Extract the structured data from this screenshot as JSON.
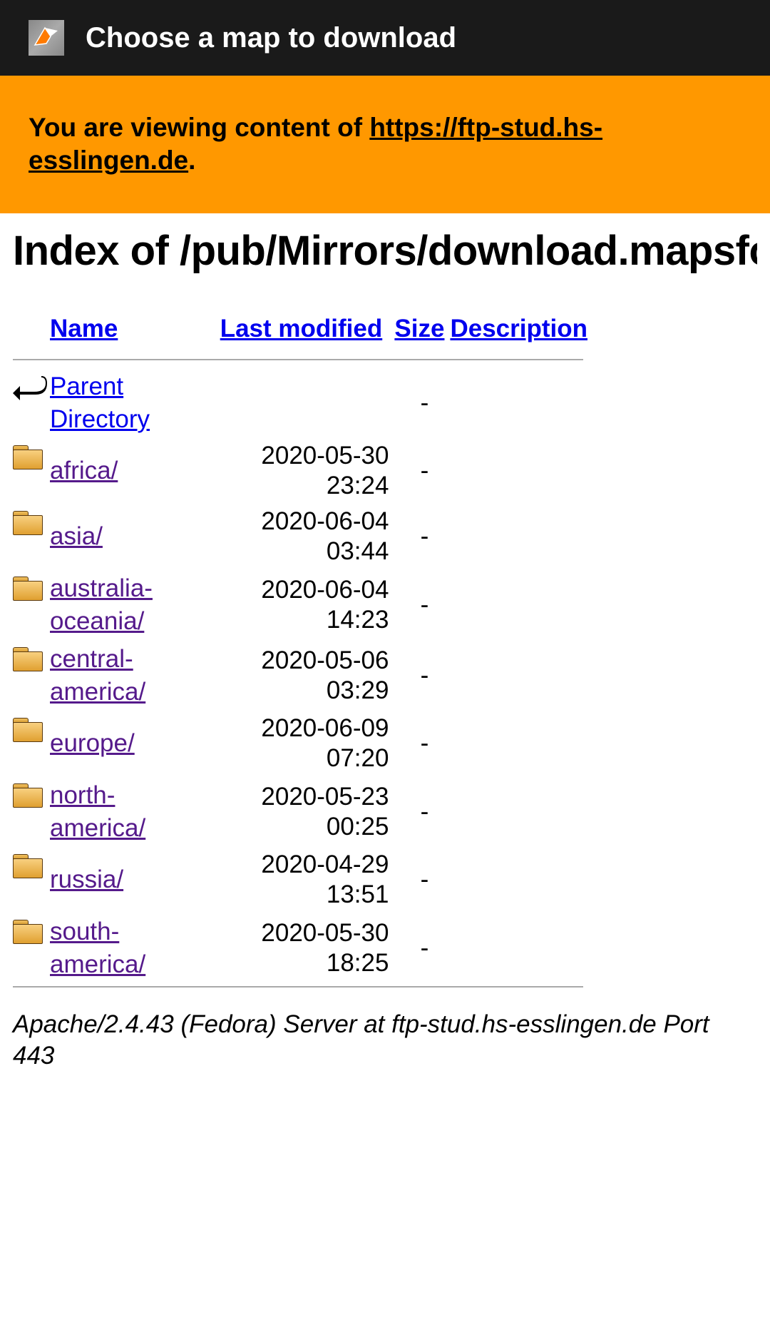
{
  "header": {
    "title": "Choose a map to download"
  },
  "notice": {
    "prefix": "You are viewing content of ",
    "link_text": "https://ftp-stud.hs-esslingen.de",
    "suffix": "."
  },
  "index_title": "Index of /pub/Mirrors/download.mapsforge.org",
  "columns": {
    "name": "Name",
    "last_modified": "Last modified",
    "size": "Size",
    "description": "Description"
  },
  "parent": {
    "label": "Parent Directory",
    "size": "-"
  },
  "entries": [
    {
      "name": "africa/",
      "date": "2020-05-30 23:24",
      "size": "-"
    },
    {
      "name": "asia/",
      "date": "2020-06-04 03:44",
      "size": "-"
    },
    {
      "name": "australia-oceania/",
      "date": "2020-06-04 14:23",
      "size": "-"
    },
    {
      "name": "central-america/",
      "date": "2020-05-06 03:29",
      "size": "-"
    },
    {
      "name": "europe/",
      "date": "2020-06-09 07:20",
      "size": "-"
    },
    {
      "name": "north-america/",
      "date": "2020-05-23 00:25",
      "size": "-"
    },
    {
      "name": "russia/",
      "date": "2020-04-29 13:51",
      "size": "-"
    },
    {
      "name": "south-america/",
      "date": "2020-05-30 18:25",
      "size": "-"
    }
  ],
  "server_line": "Apache/2.4.43 (Fedora) Server at ftp-stud.hs-esslingen.de Port 443"
}
